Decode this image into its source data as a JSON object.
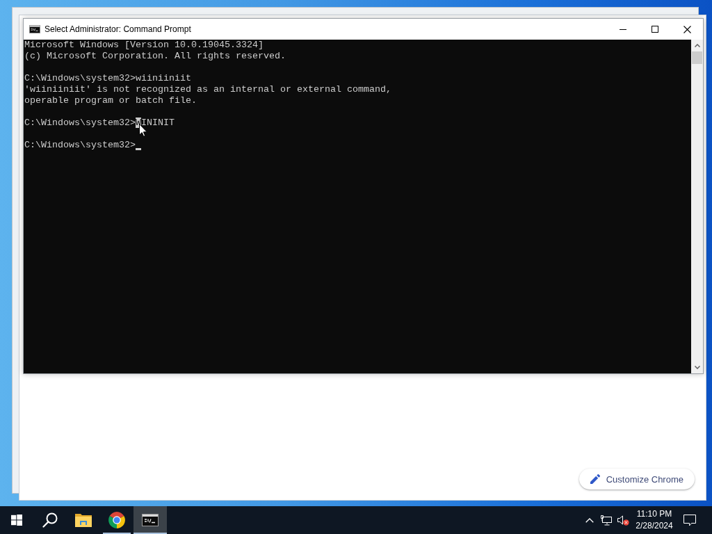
{
  "browser_window": {
    "customize_button": {
      "label": "Customize Chrome"
    }
  },
  "console_window": {
    "title": "Select Administrator: Command Prompt",
    "blocks": [
      {
        "lines": [
          {
            "segments": [
              {
                "text": "Microsoft Windows [Version 10.0.19045.3324]",
                "selected": false
              }
            ],
            "cursor": false
          },
          {
            "segments": [
              {
                "text": "(c) Microsoft Corporation. All rights reserved.",
                "selected": false
              }
            ],
            "cursor": false
          }
        ]
      },
      {
        "lines": [
          {
            "segments": [
              {
                "text": "C:\\Windows\\system32>wiiniiniit",
                "selected": false
              }
            ],
            "cursor": false
          },
          {
            "segments": [
              {
                "text": "'wiiniiniit' is not recognized as an internal or external command,",
                "selected": false
              }
            ],
            "cursor": false
          },
          {
            "segments": [
              {
                "text": "operable program or batch file.",
                "selected": false
              }
            ],
            "cursor": false
          }
        ]
      },
      {
        "lines": [
          {
            "segments": [
              {
                "text": "C:\\Windows\\system32>",
                "selected": false
              },
              {
                "text": "W",
                "selected": true
              },
              {
                "text": "ININIT",
                "selected": false
              }
            ],
            "cursor": false
          }
        ]
      },
      {
        "lines": [
          {
            "segments": [
              {
                "text": "C:\\Windows\\system32>",
                "selected": false
              }
            ],
            "cursor": true
          }
        ]
      }
    ]
  },
  "taskbar": {
    "items": [
      {
        "kind": "start",
        "running": false,
        "active": false
      },
      {
        "kind": "search",
        "running": false,
        "active": false
      },
      {
        "kind": "folder",
        "running": false,
        "active": false
      },
      {
        "kind": "browser",
        "running": true,
        "active": false
      },
      {
        "kind": "terminal",
        "running": true,
        "active": true
      }
    ],
    "tray": {
      "volume": {
        "muted": true
      },
      "clock": {
        "time": "11:10 PM",
        "date": "2/28/2024"
      }
    }
  }
}
